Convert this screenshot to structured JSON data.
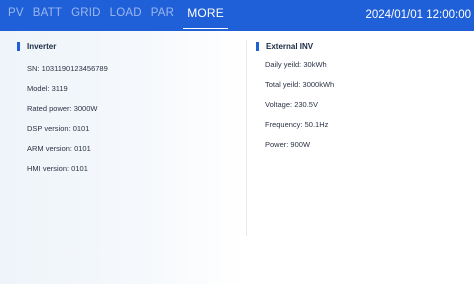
{
  "header": {
    "tabs": [
      {
        "label": "PV",
        "active": false
      },
      {
        "label": "BATT",
        "active": false
      },
      {
        "label": "GRID",
        "active": false
      },
      {
        "label": "LOAD",
        "active": false
      },
      {
        "label": "PAR",
        "active": false
      },
      {
        "label": "MORE",
        "active": true
      }
    ],
    "datetime": "2024/01/01 12:00:00"
  },
  "inverter": {
    "title": "Inverter",
    "rows": [
      "SN: 1031190123456789",
      "Model: 3119",
      "Rated power: 3000W",
      "DSP version: 0101",
      "ARM version: 0101",
      "HMI version: 0101"
    ]
  },
  "external_inv": {
    "title": "External INV",
    "rows": [
      "Daily yeild: 30kWh",
      "Total yeild: 3000kWh",
      "Voltage: 230.5V",
      "Frequency: 50.1Hz",
      "Power: 900W"
    ]
  },
  "colors": {
    "header_bg": "#1f5fd8",
    "accent": "#1f5fd8",
    "text": "#2b3445"
  }
}
